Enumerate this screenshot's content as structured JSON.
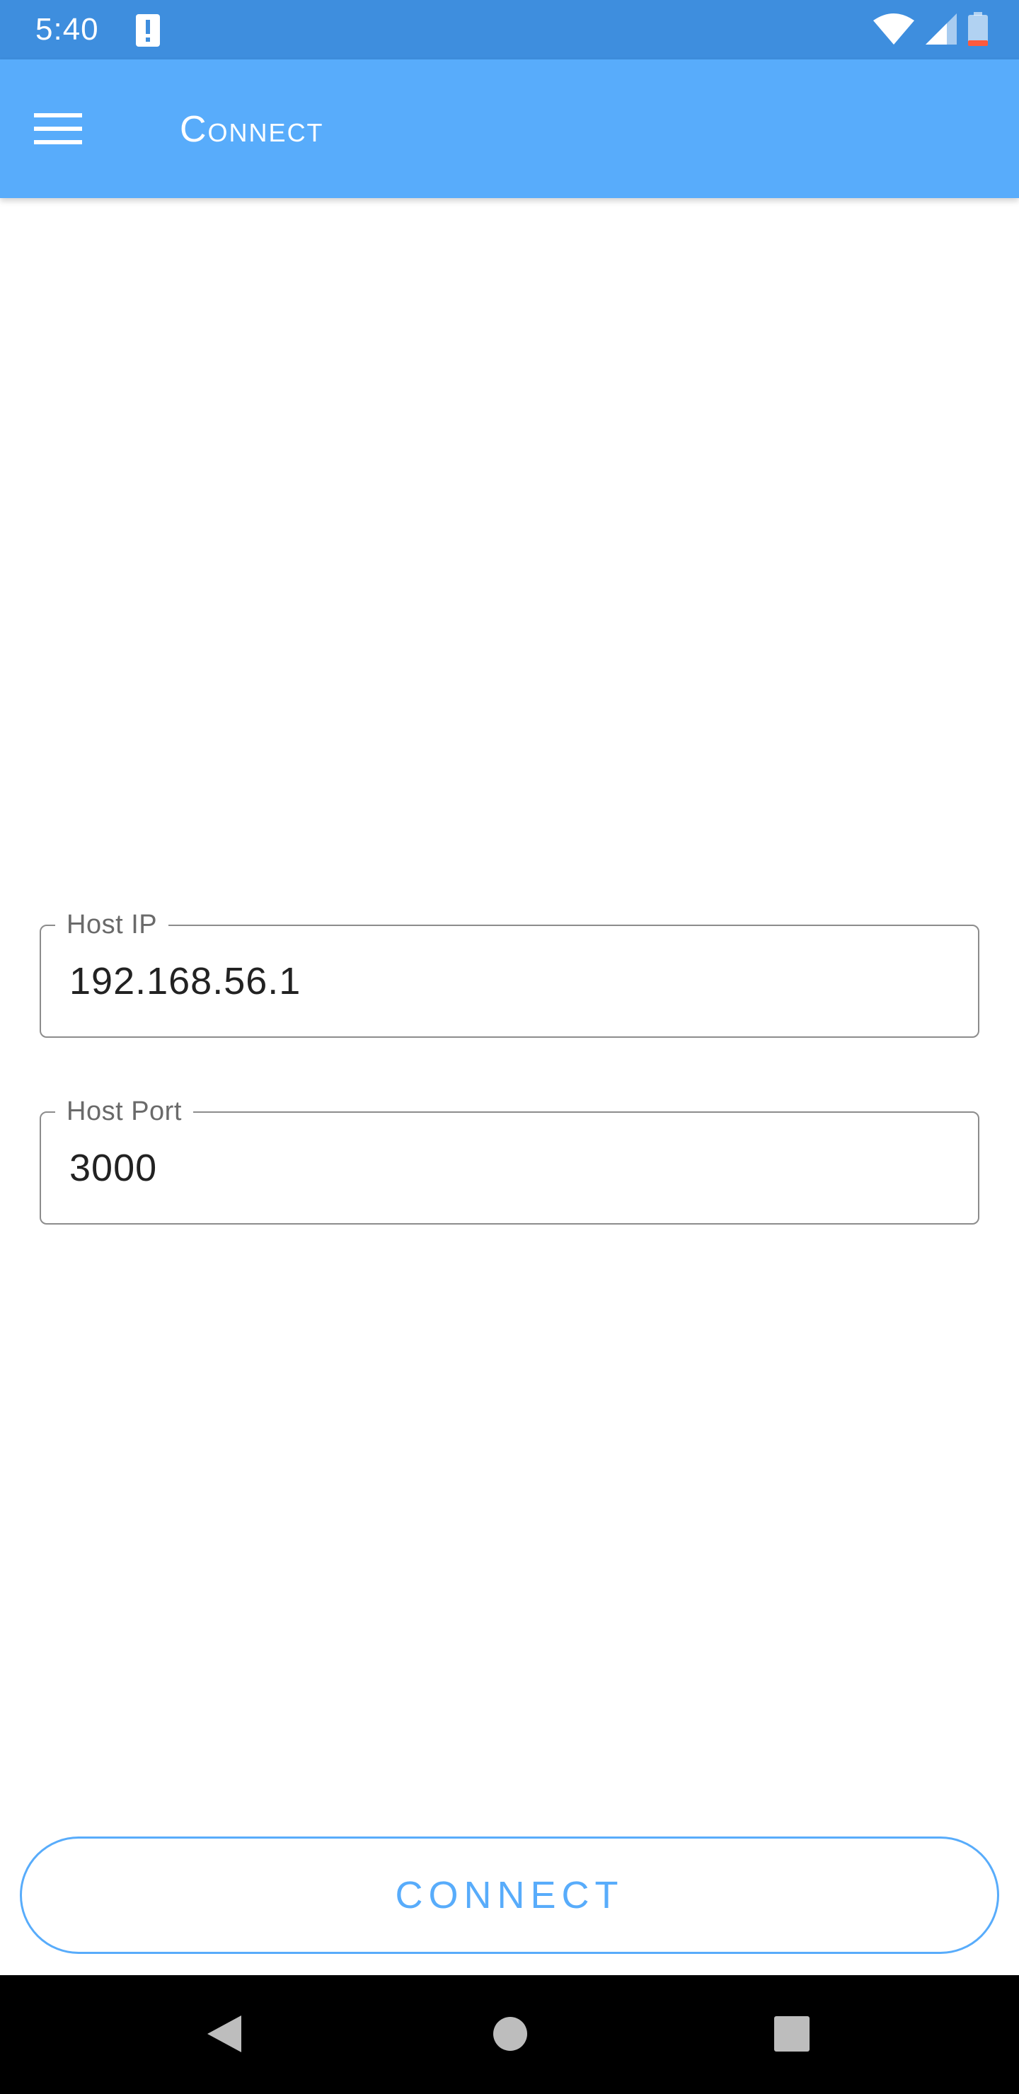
{
  "status_bar": {
    "time": "5:40",
    "icons": [
      "alert-icon",
      "wifi-icon",
      "cell-signal-icon",
      "battery-low-icon"
    ]
  },
  "app_bar": {
    "title": "Connect",
    "menu_icon": "hamburger-menu-icon",
    "color": "#58acfb"
  },
  "form": {
    "host_ip": {
      "label": "Host IP",
      "value": "192.168.56.1"
    },
    "host_port": {
      "label": "Host Port",
      "value": "3000"
    }
  },
  "connect_button": {
    "label": "CONNECT",
    "color": "#58acfb"
  },
  "nav_bar": {
    "buttons": [
      "back-icon",
      "home-icon",
      "recents-icon"
    ]
  }
}
